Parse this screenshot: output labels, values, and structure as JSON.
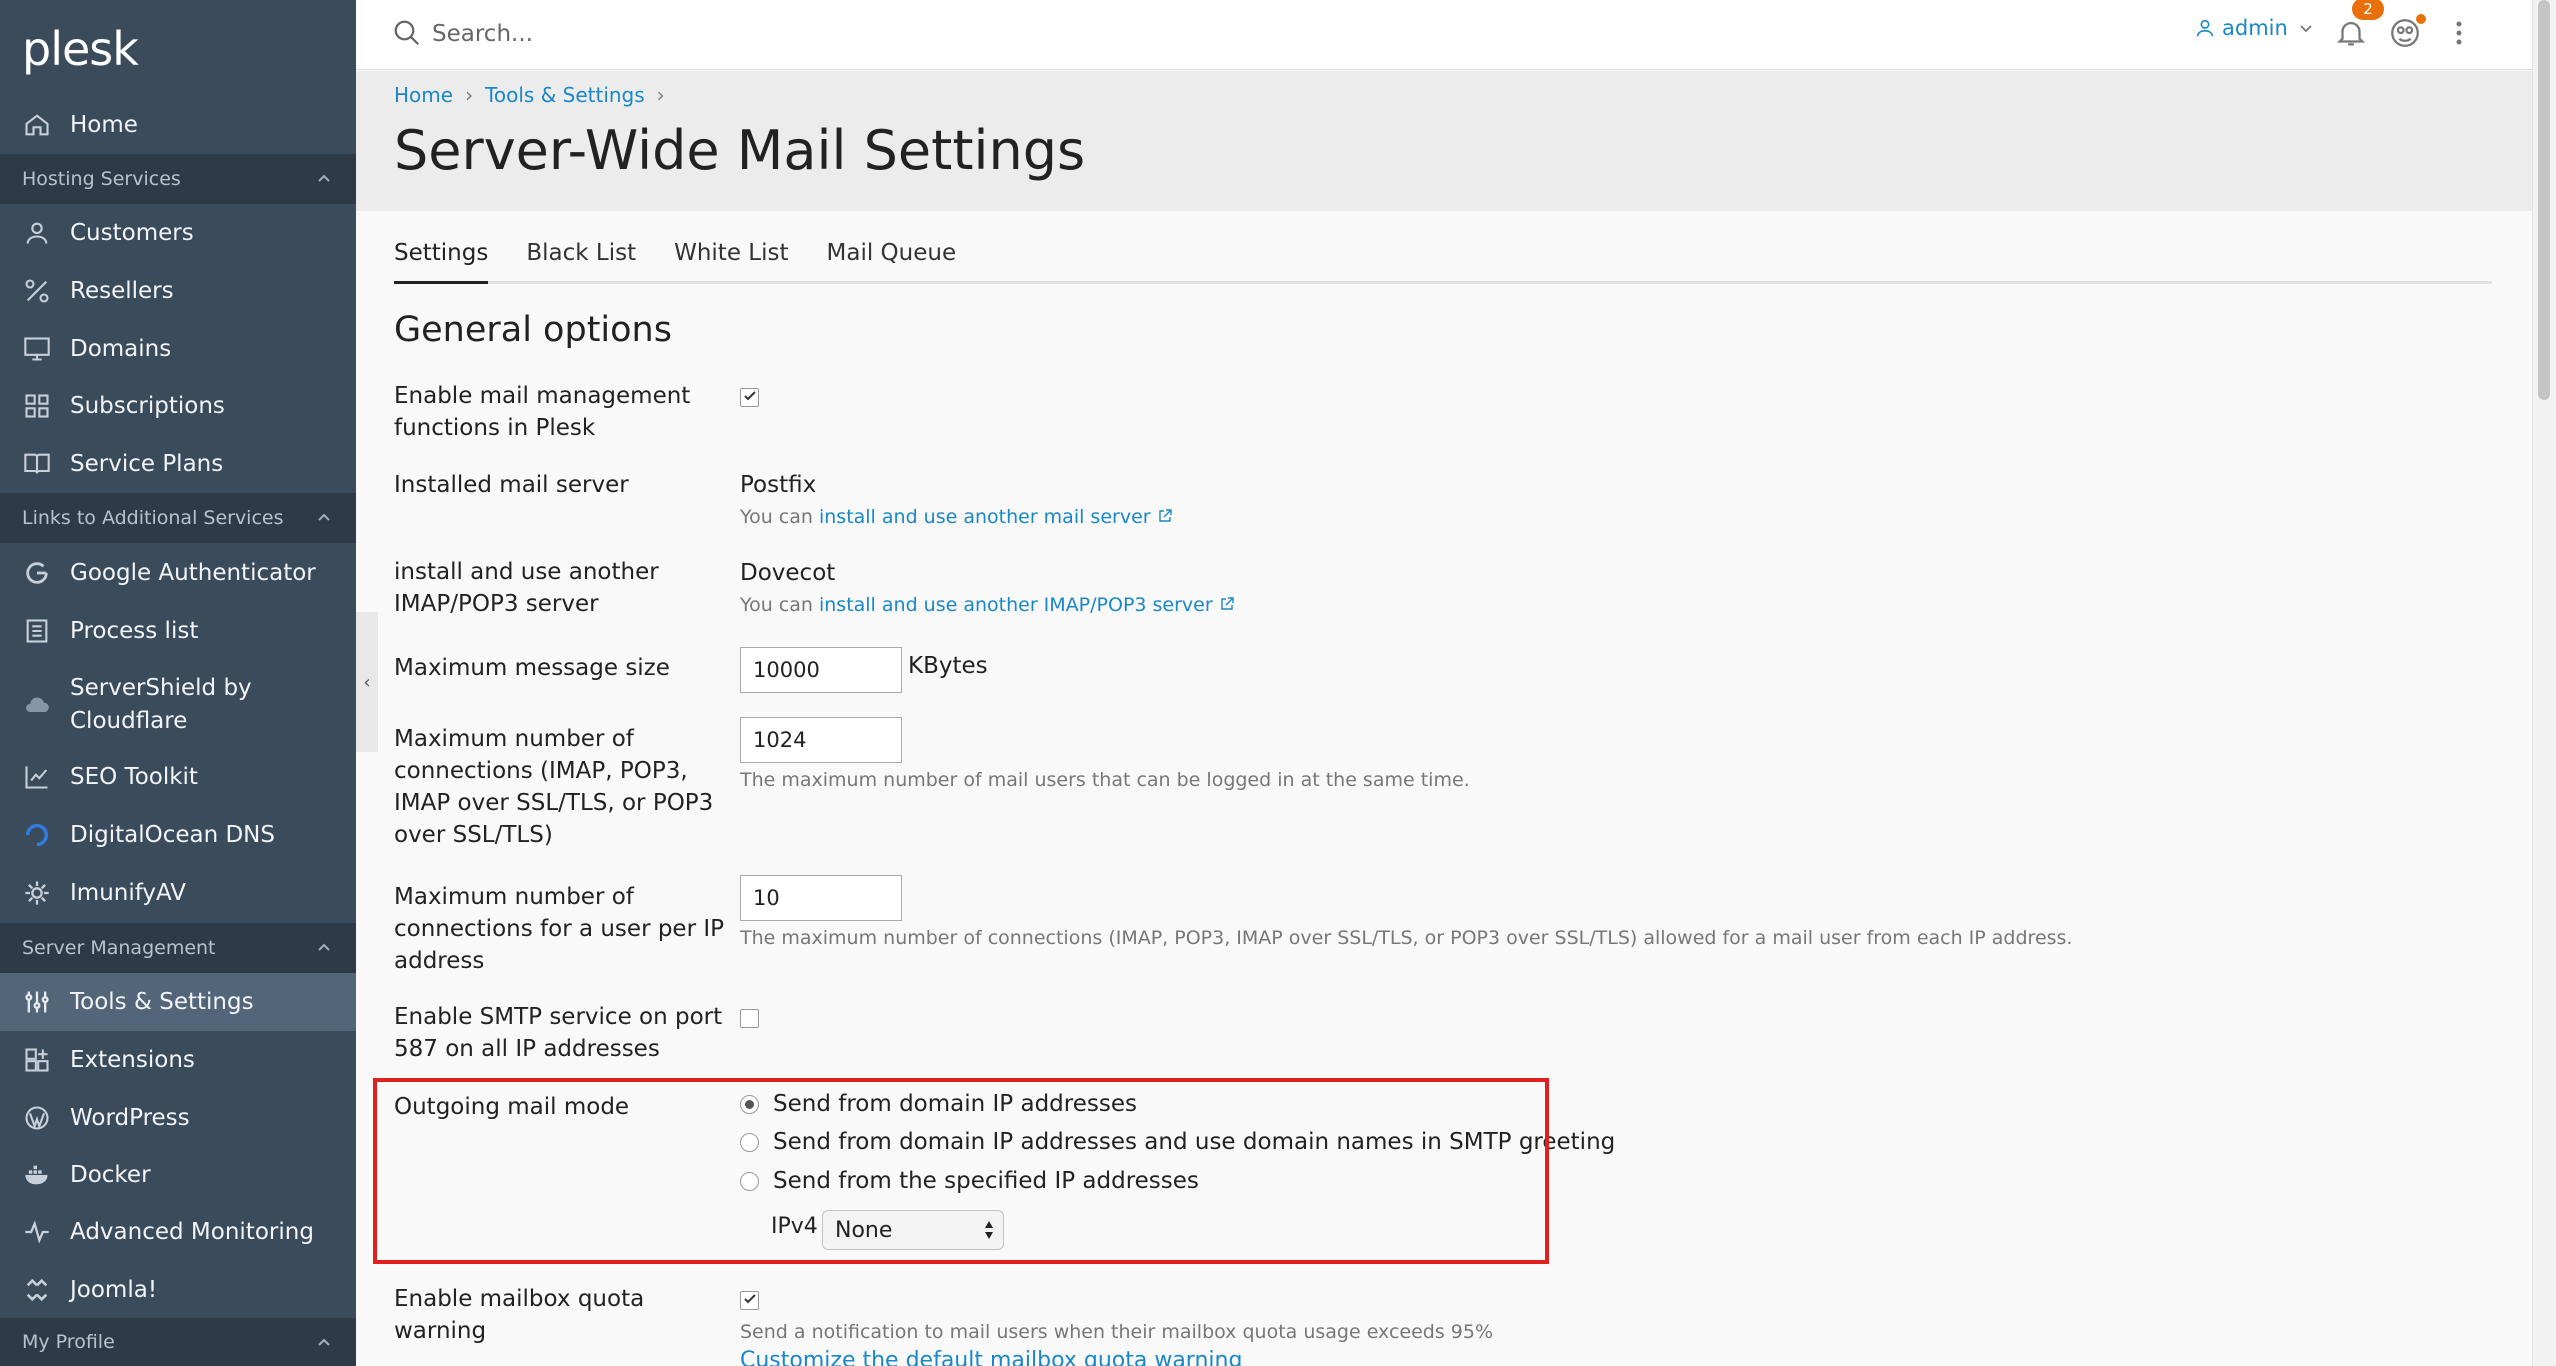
{
  "app": {
    "logo": "plesk"
  },
  "sidebar": {
    "items": [
      {
        "label": "Home",
        "icon": "home-icon"
      },
      {
        "label": "Customers",
        "icon": "user-icon"
      },
      {
        "label": "Resellers",
        "icon": "percent-icon"
      },
      {
        "label": "Domains",
        "icon": "monitor-icon"
      },
      {
        "label": "Subscriptions",
        "icon": "grid-icon"
      },
      {
        "label": "Service Plans",
        "icon": "book-icon"
      },
      {
        "label": "Google Authenticator",
        "icon": "google-icon"
      },
      {
        "label": "Process list",
        "icon": "list-icon"
      },
      {
        "label": "ServerShield by Cloudflare",
        "icon": "cloud-icon"
      },
      {
        "label": "SEO Toolkit",
        "icon": "chart-icon"
      },
      {
        "label": "DigitalOcean DNS",
        "icon": "digitalocean-icon"
      },
      {
        "label": "ImunifyAV",
        "icon": "gear-icon"
      },
      {
        "label": "Tools & Settings",
        "icon": "sliders-icon"
      },
      {
        "label": "Extensions",
        "icon": "extensions-icon"
      },
      {
        "label": "WordPress",
        "icon": "wordpress-icon"
      },
      {
        "label": "Docker",
        "icon": "docker-icon"
      },
      {
        "label": "Advanced Monitoring",
        "icon": "monitoring-icon"
      },
      {
        "label": "Joomla!",
        "icon": "joomla-icon"
      }
    ],
    "sections": [
      {
        "label": "Hosting Services"
      },
      {
        "label": "Links to Additional Services"
      },
      {
        "label": "Server Management"
      },
      {
        "label": "My Profile"
      }
    ]
  },
  "header": {
    "search_placeholder": "Search...",
    "user": "admin",
    "notifications_count": "2"
  },
  "breadcrumb": [
    "Home",
    "Tools & Settings"
  ],
  "page_title": "Server-Wide Mail Settings",
  "tabs": [
    "Settings",
    "Black List",
    "White List",
    "Mail Queue"
  ],
  "section_title": "General options",
  "form": {
    "enable_mail": {
      "label": "Enable mail management functions in Plesk",
      "checked": true
    },
    "mail_server": {
      "label": "Installed mail server",
      "value": "Postfix",
      "hint_prefix": "You can ",
      "hint_link": "install and use another mail server"
    },
    "imap_server": {
      "label": "install and use another IMAP/POP3 server",
      "value": "Dovecot",
      "hint_prefix": "You can ",
      "hint_link": "install and use another IMAP/POP3 server"
    },
    "max_message_size": {
      "label": "Maximum message size",
      "value": "10000",
      "unit": "KBytes"
    },
    "max_connections": {
      "label": "Maximum number of connections (IMAP, POP3, IMAP over SSL/TLS, or POP3 over SSL/TLS)",
      "value": "1024",
      "hint": "The maximum number of mail users that can be logged in at the same time."
    },
    "max_connections_ip": {
      "label": "Maximum number of connections for a user per IP address",
      "value": "10",
      "hint": "The maximum number of connections (IMAP, POP3, IMAP over SSL/TLS, or POP3 over SSL/TLS) allowed for a mail user from each IP address."
    },
    "smtp_587": {
      "label": "Enable SMTP service on port 587 on all IP addresses",
      "checked": false
    },
    "outgoing_mode": {
      "label": "Outgoing mail mode",
      "options": [
        "Send from domain IP addresses",
        "Send from domain IP addresses and use domain names in SMTP greeting",
        "Send from the specified IP addresses"
      ],
      "selected_index": 0,
      "ipv4_label": "IPv4",
      "ipv4_value": "None"
    },
    "quota_warning": {
      "label": "Enable mailbox quota warning",
      "checked": true,
      "hint": "Send a notification to mail users when their mailbox quota usage exceeds 95%",
      "link": "Customize the default mailbox quota warning"
    }
  },
  "colors": {
    "sidebar": "#3a4b5c",
    "accent": "#1a87c6",
    "highlight": "#e0201c",
    "badge": "#e8700a"
  }
}
